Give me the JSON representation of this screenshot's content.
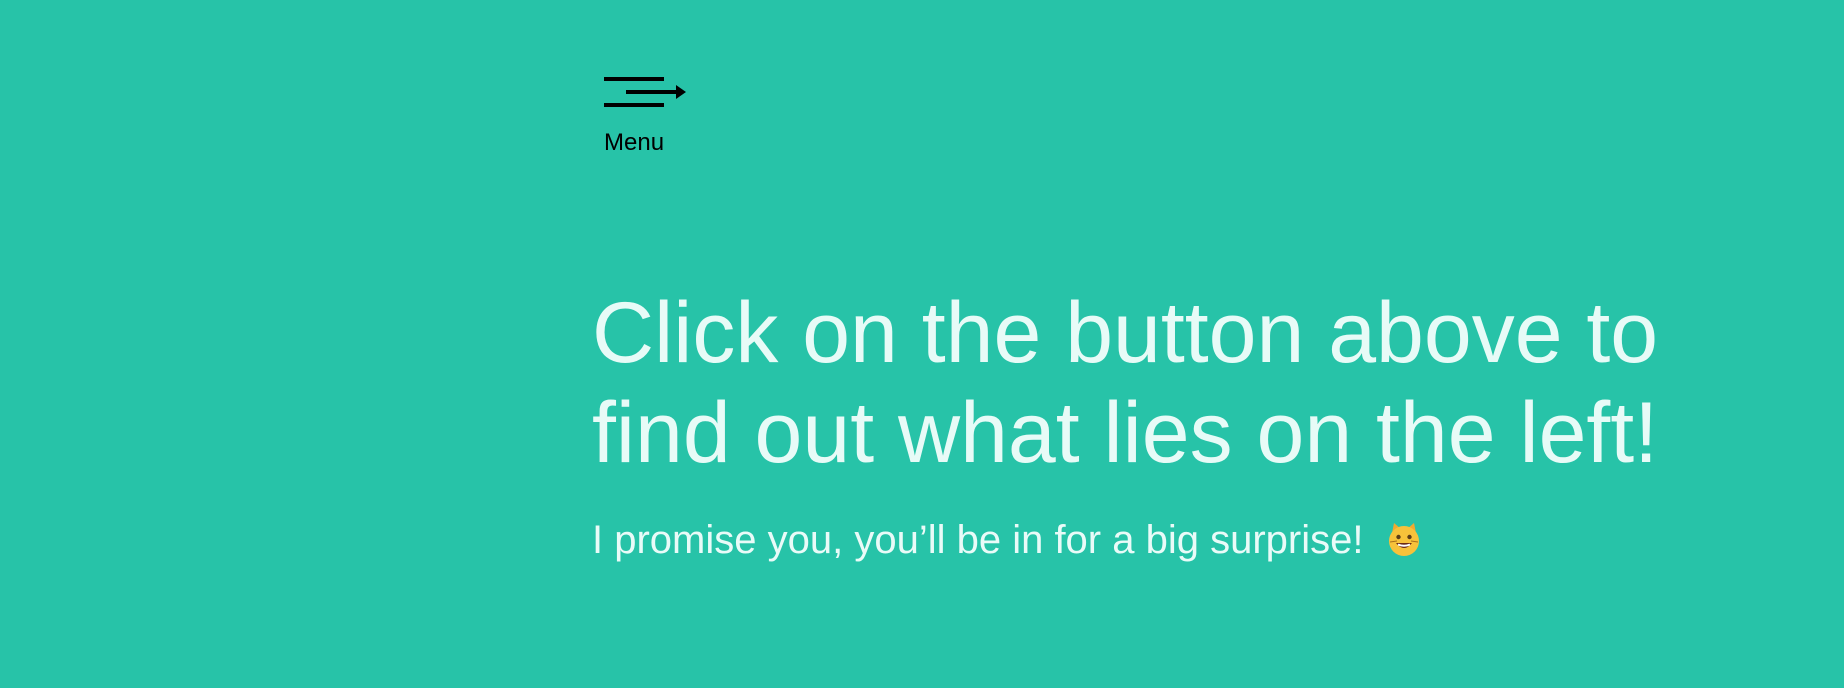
{
  "menu": {
    "label": "Menu",
    "icon": "menu-arrow-icon"
  },
  "hero": {
    "title": "Click on the button above to find out what lies on the left!",
    "subtitle": "I promise you, you’ll be in for a big surprise!",
    "emoji": "grinning-cat-icon"
  },
  "colors": {
    "background": "#27c3a8",
    "title_text": "#e7fbf7",
    "subtitle_text": "#e9fbf8",
    "menu_text": "#000000",
    "emoji_face": "#f7c23a"
  }
}
